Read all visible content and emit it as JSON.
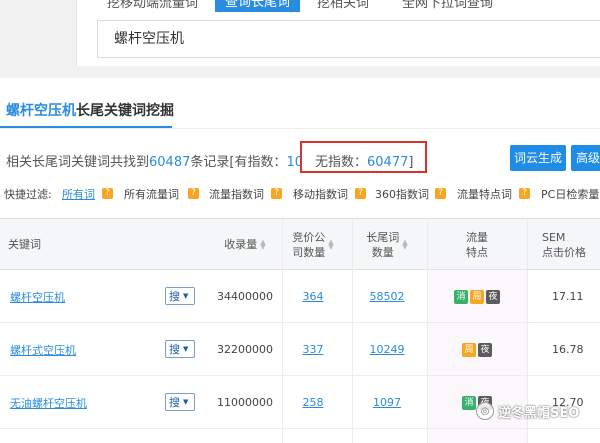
{
  "top_tabs": [
    {
      "label": "挖移动端流量词"
    },
    {
      "label": "查询长尾词",
      "active": true
    },
    {
      "label": "挖相关词"
    },
    {
      "label": "全网下拉词查询"
    }
  ],
  "search": {
    "value": "螺杆空压机"
  },
  "section": {
    "keyword": "螺杆空压机",
    "title_suffix": "长尾关键词挖掘"
  },
  "summary": {
    "prefix": "相关长尾词关键词共找到",
    "total": "60487",
    "mid": "条记录[有指数：",
    "with_index": "10",
    "no_index_label": "无指数：",
    "no_index": "60477",
    "suffix": "]"
  },
  "buttons": {
    "word_cloud": "词云生成",
    "advanced": "高级"
  },
  "filters": {
    "label": "快捷过滤:",
    "items": [
      {
        "label": "所有词",
        "active": true
      },
      {
        "label": "所有流量词"
      },
      {
        "label": "流量指数词"
      },
      {
        "label": "移动指数词"
      },
      {
        "label": "360指数词"
      },
      {
        "label": "流量特点词"
      },
      {
        "label": "PC日检索量"
      }
    ],
    "badge": "?"
  },
  "table": {
    "headers": {
      "keyword": "关键词",
      "indexed": "收录量",
      "bid_l1": "竞价公",
      "bid_l2": "司数量",
      "longtail_l1": "长尾词",
      "longtail_l2": "数量",
      "traffic_l1": "流量",
      "traffic_l2": "特点",
      "sem_l1": "SEM",
      "sem_l2": "点击价格"
    },
    "search_btn": "搜",
    "rows": [
      {
        "kw_pre": "",
        "kw_hl": "螺杆空压机",
        "kw_post": "",
        "indexed": "34400000",
        "bid": "364",
        "longtail": "58502",
        "tags": [
          "消",
          "周",
          "夜"
        ],
        "sem": "17.11"
      },
      {
        "kw_pre": "",
        "kw_hl": "螺杆式空压机",
        "kw_post": "",
        "indexed": "32200000",
        "bid": "337",
        "longtail": "10249",
        "tags": [
          "周",
          "夜"
        ],
        "sem": "16.78"
      },
      {
        "kw_pre": "无油",
        "kw_hl": "螺杆空压机",
        "kw_post": "",
        "indexed": "11000000",
        "bid": "258",
        "longtail": "1097",
        "tags": [
          "消",
          "夜"
        ],
        "sem": "12.70"
      }
    ]
  },
  "watermark": {
    "text": "逆冬黑帽SEO"
  }
}
